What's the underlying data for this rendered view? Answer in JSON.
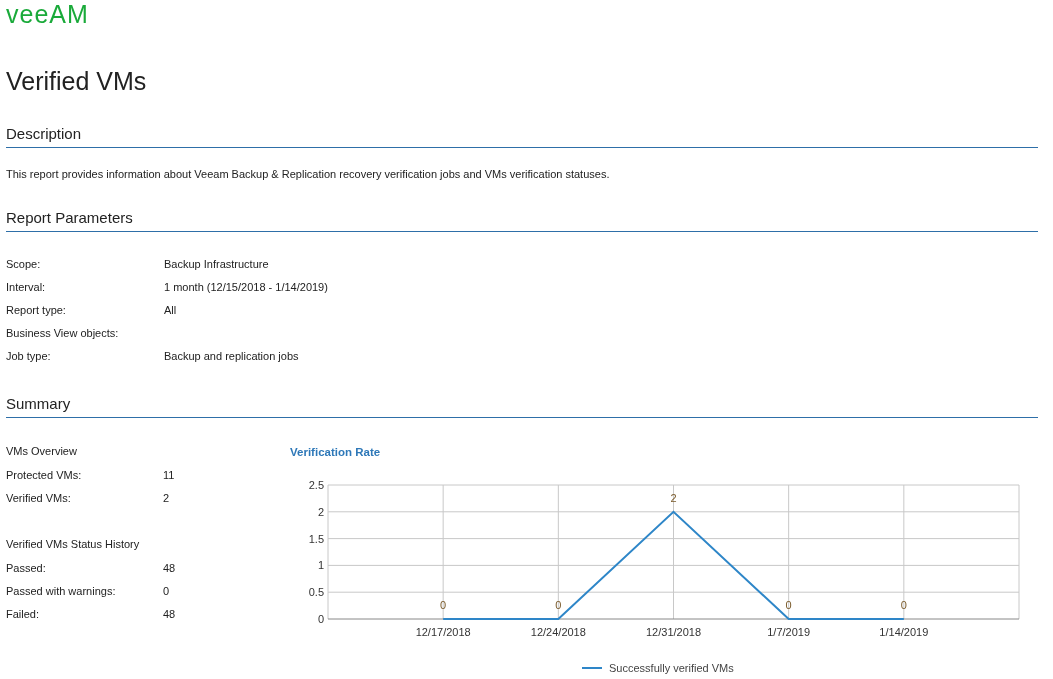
{
  "logo": "veeAM",
  "title": "Verified VMs",
  "description": {
    "heading": "Description",
    "text": "This report provides information about Veeam Backup & Replication recovery verification jobs and VMs verification statuses."
  },
  "report_parameters": {
    "heading": "Report Parameters",
    "rows": [
      {
        "label": "Scope:",
        "value": "Backup Infrastructure"
      },
      {
        "label": "Interval:",
        "value": "1 month (12/15/2018 - 1/14/2019)"
      },
      {
        "label": "Report type:",
        "value": "All"
      },
      {
        "label": "Business View objects:"
      },
      {
        "label": "Job type:",
        "value": "Backup and replication jobs"
      }
    ]
  },
  "summary": {
    "heading": "Summary",
    "groups": [
      {
        "title": "VMs Overview",
        "rows": [
          {
            "label": "Protected VMs:",
            "value": "11"
          },
          {
            "label": "Verified VMs:",
            "value": "2"
          }
        ]
      },
      {
        "title": "Verified VMs Status History",
        "rows": [
          {
            "label": "Passed:",
            "value": "48"
          },
          {
            "label": "Passed with warnings:",
            "value": "0"
          },
          {
            "label": "Failed:",
            "value": "48"
          }
        ]
      }
    ],
    "chart_data": {
      "type": "line",
      "title": "Verification Rate",
      "categories": [
        "12/17/2018",
        "12/24/2018",
        "12/31/2018",
        "1/7/2019",
        "1/14/2019"
      ],
      "series": [
        {
          "name": "Successfully verified VMs",
          "color": "#2e86c8",
          "values": [
            0,
            0,
            2,
            0,
            0
          ]
        }
      ],
      "ylim": [
        0,
        2.5
      ],
      "yticks": [
        0,
        0.5,
        1,
        1.5,
        2,
        2.5
      ],
      "data_labels": true,
      "grid": true
    }
  }
}
